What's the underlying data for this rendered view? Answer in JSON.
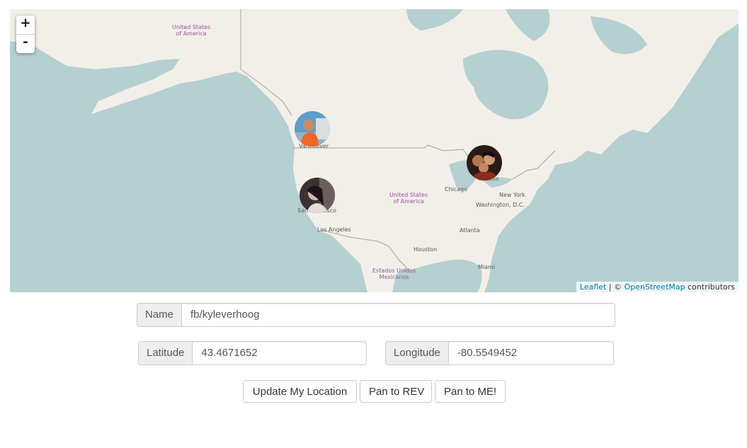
{
  "map": {
    "zoom_in": "+",
    "zoom_out": "-",
    "labels": {
      "usa_north": "United States\nof America",
      "usa_center": "United States\nof America",
      "mexico": "Estados Unidos\nMexicanos",
      "vancouver": "Vancouver",
      "san_francisco": "San Francisco",
      "toronto": "Toronto",
      "los_angeles": "Los Angeles",
      "chicago": "Chicago",
      "new_york": "New York",
      "washington": "Washington, D.C.",
      "atlanta": "Atlanta",
      "houston": "Houston",
      "miami": "Miami"
    },
    "markers": [
      {
        "name": "vancouver-avatar-marker",
        "icon": "person-avatar"
      },
      {
        "name": "san-francisco-avatar-marker",
        "icon": "person-avatar"
      },
      {
        "name": "toronto-avatar-marker",
        "icon": "group-avatar"
      }
    ],
    "attribution": {
      "leaflet": "Leaflet",
      "separator": " | © ",
      "osm": "OpenStreetMap",
      "suffix": " contributors"
    },
    "colors": {
      "water": "#b5d0d0",
      "land": "#f2efe9",
      "border": "#a0a0a0",
      "country_label": "#9b4f9b",
      "link": "#0078a8"
    }
  },
  "form": {
    "name": {
      "label": "Name",
      "value": "fb/kyleverhoog"
    },
    "latitude": {
      "label": "Latitude",
      "value": "43.4671652"
    },
    "longitude": {
      "label": "Longitude",
      "value": "-80.5549452"
    },
    "buttons": {
      "update": "Update My Location",
      "pan_rev": "Pan to REV",
      "pan_me": "Pan to ME!"
    }
  }
}
